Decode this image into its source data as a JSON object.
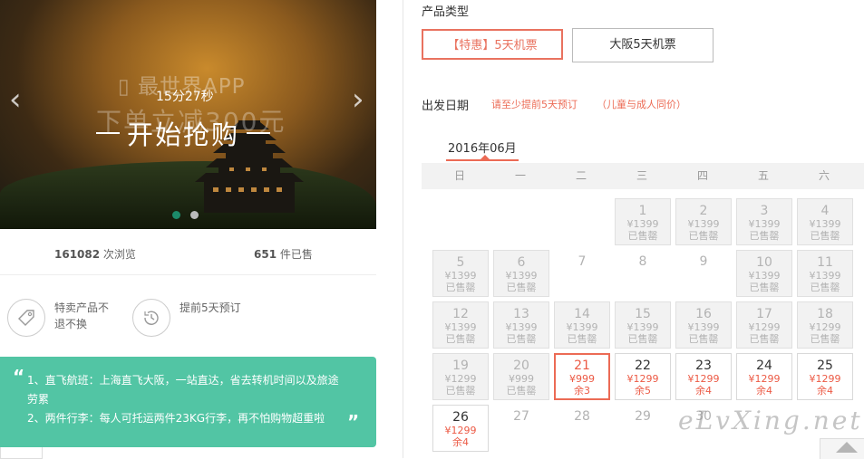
{
  "banner": {
    "app_text": "最世界APP",
    "promo_ghost": "下单立减300元",
    "countdown": "15分27秒",
    "start_label": "开始抢购",
    "prev_arrow": "‹",
    "next_arrow": "›",
    "slides_total": 2,
    "active_slide": 1
  },
  "stats": {
    "views_count": "161082",
    "views_label": " 次浏览",
    "sold_count": "651",
    "sold_label": " 件已售"
  },
  "features": [
    {
      "icon": "tag-icon",
      "text": "特卖产品不退不换"
    },
    {
      "icon": "clock-icon",
      "text": "提前5天预订"
    }
  ],
  "note": {
    "open_quote": "“",
    "close_quote": "”",
    "line1": "1、直飞航班：上海直飞大阪，一站直达，省去转机时间以及旅途劳累",
    "line2": "2、两件行李：每人可托运两件23KG行李，再不怕购物超重啦"
  },
  "product_type": {
    "title": "产品类型",
    "options": [
      "【特惠】5天机票",
      "大阪5天机票"
    ],
    "selected": 0
  },
  "departure": {
    "title": "出发日期",
    "hint1": "请至少提前5天预订",
    "hint2": "（儿童与成人同价）",
    "month": "2016年06月"
  },
  "calendar": {
    "weekdays": [
      "日",
      "一",
      "二",
      "三",
      "四",
      "五",
      "六"
    ],
    "colors": {
      "accent": "#ec6b55",
      "sold_bg": "#f2f2f2",
      "note_bg": "#52c5a4"
    },
    "rows": [
      [
        {
          "type": "blank"
        },
        {
          "type": "blank"
        },
        {
          "type": "blank"
        },
        {
          "type": "soldout",
          "day": "1",
          "price": "¥1399",
          "status": "已售罄"
        },
        {
          "type": "soldout",
          "day": "2",
          "price": "¥1399",
          "status": "已售罄"
        },
        {
          "type": "soldout",
          "day": "3",
          "price": "¥1399",
          "status": "已售罄"
        },
        {
          "type": "soldout",
          "day": "4",
          "price": "¥1399",
          "status": "已售罄"
        }
      ],
      [
        {
          "type": "soldout",
          "day": "5",
          "price": "¥1399",
          "status": "已售罄"
        },
        {
          "type": "soldout",
          "day": "6",
          "price": "¥1399",
          "status": "已售罄"
        },
        {
          "type": "empty",
          "day": "7"
        },
        {
          "type": "empty",
          "day": "8"
        },
        {
          "type": "empty",
          "day": "9"
        },
        {
          "type": "soldout",
          "day": "10",
          "price": "¥1399",
          "status": "已售罄"
        },
        {
          "type": "soldout",
          "day": "11",
          "price": "¥1399",
          "status": "已售罄"
        }
      ],
      [
        {
          "type": "soldout",
          "day": "12",
          "price": "¥1399",
          "status": "已售罄"
        },
        {
          "type": "soldout",
          "day": "13",
          "price": "¥1399",
          "status": "已售罄"
        },
        {
          "type": "soldout",
          "day": "14",
          "price": "¥1399",
          "status": "已售罄"
        },
        {
          "type": "soldout",
          "day": "15",
          "price": "¥1399",
          "status": "已售罄"
        },
        {
          "type": "soldout",
          "day": "16",
          "price": "¥1399",
          "status": "已售罄"
        },
        {
          "type": "soldout",
          "day": "17",
          "price": "¥1299",
          "status": "已售罄"
        },
        {
          "type": "soldout",
          "day": "18",
          "price": "¥1299",
          "status": "已售罄"
        }
      ],
      [
        {
          "type": "soldout",
          "day": "19",
          "price": "¥1299",
          "status": "已售罄"
        },
        {
          "type": "soldout",
          "day": "20",
          "price": "¥999",
          "status": "已售罄"
        },
        {
          "type": "sel",
          "day": "21",
          "price": "¥999",
          "status": "余3"
        },
        {
          "type": "avail",
          "day": "22",
          "price": "¥1299",
          "status": "余5"
        },
        {
          "type": "avail",
          "day": "23",
          "price": "¥1299",
          "status": "余4"
        },
        {
          "type": "avail",
          "day": "24",
          "price": "¥1299",
          "status": "余4"
        },
        {
          "type": "avail",
          "day": "25",
          "price": "¥1299",
          "status": "余4"
        }
      ],
      [
        {
          "type": "avail",
          "day": "26",
          "price": "¥1299",
          "status": "余4"
        },
        {
          "type": "empty",
          "day": "27"
        },
        {
          "type": "empty",
          "day": "28"
        },
        {
          "type": "empty",
          "day": "29"
        },
        {
          "type": "empty",
          "day": "30"
        },
        {
          "type": "blank"
        },
        {
          "type": "blank"
        }
      ]
    ]
  },
  "watermark": "eLvXing.net"
}
